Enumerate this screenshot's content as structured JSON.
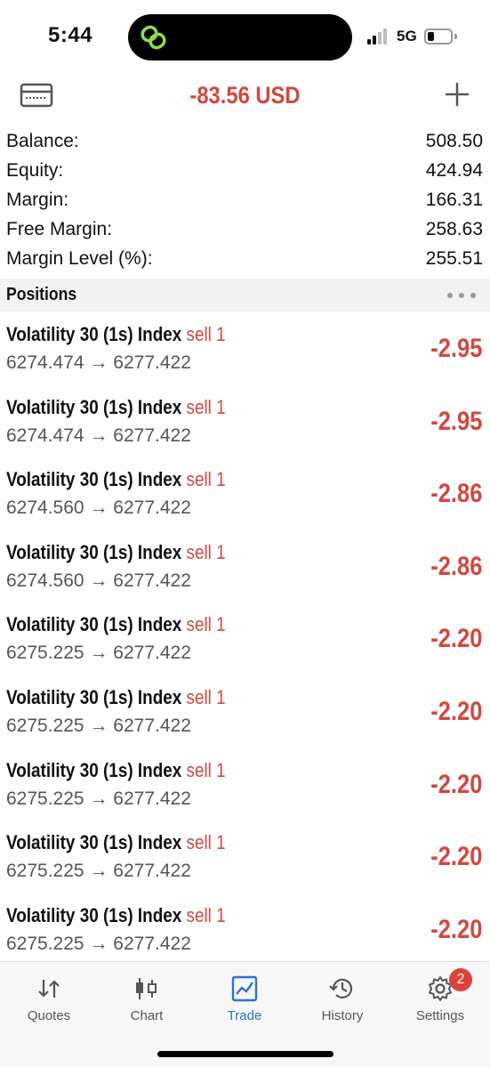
{
  "status_bar": {
    "time": "5:44",
    "network": "5G",
    "island_icon": "linked-rings-icon",
    "island_icon_color": "#8be04e"
  },
  "header": {
    "title": "-83.56 USD",
    "left_icon": "account-card-icon",
    "right_icon": "plus-icon",
    "title_color": "#d2473e"
  },
  "summary": [
    {
      "label": "Balance:",
      "value": "508.50"
    },
    {
      "label": "Equity:",
      "value": "424.94"
    },
    {
      "label": "Margin:",
      "value": "166.31"
    },
    {
      "label": "Free Margin:",
      "value": "258.63"
    },
    {
      "label": "Margin Level (%):",
      "value": "255.51"
    }
  ],
  "positions_section": {
    "title": "Positions",
    "menu_icon": "more-dots-icon"
  },
  "positions": [
    {
      "symbol": "Volatility 30 (1s) Index",
      "type": "sell 1",
      "open_price": "6274.474",
      "arrow": "→",
      "current_price": "6277.422",
      "profit": "-2.95"
    },
    {
      "symbol": "Volatility 30 (1s) Index",
      "type": "sell 1",
      "open_price": "6274.474",
      "arrow": "→",
      "current_price": "6277.422",
      "profit": "-2.95"
    },
    {
      "symbol": "Volatility 30 (1s) Index",
      "type": "sell 1",
      "open_price": "6274.560",
      "arrow": "→",
      "current_price": "6277.422",
      "profit": "-2.86"
    },
    {
      "symbol": "Volatility 30 (1s) Index",
      "type": "sell 1",
      "open_price": "6274.560",
      "arrow": "→",
      "current_price": "6277.422",
      "profit": "-2.86"
    },
    {
      "symbol": "Volatility 30 (1s) Index",
      "type": "sell 1",
      "open_price": "6275.225",
      "arrow": "→",
      "current_price": "6277.422",
      "profit": "-2.20"
    },
    {
      "symbol": "Volatility 30 (1s) Index",
      "type": "sell 1",
      "open_price": "6275.225",
      "arrow": "→",
      "current_price": "6277.422",
      "profit": "-2.20"
    },
    {
      "symbol": "Volatility 30 (1s) Index",
      "type": "sell 1",
      "open_price": "6275.225",
      "arrow": "→",
      "current_price": "6277.422",
      "profit": "-2.20"
    },
    {
      "symbol": "Volatility 30 (1s) Index",
      "type": "sell 1",
      "open_price": "6275.225",
      "arrow": "→",
      "current_price": "6277.422",
      "profit": "-2.20"
    },
    {
      "symbol": "Volatility 30 (1s) Index",
      "type": "sell 1",
      "open_price": "6275.225",
      "arrow": "→",
      "current_price": "6277.422",
      "profit": "-2.20"
    }
  ],
  "tabs": [
    {
      "label": "Quotes",
      "icon": "quotes-arrows-icon"
    },
    {
      "label": "Chart",
      "icon": "candlestick-icon"
    },
    {
      "label": "Trade",
      "icon": "trade-chart-icon",
      "active": true
    },
    {
      "label": "History",
      "icon": "history-clock-icon"
    },
    {
      "label": "Settings",
      "icon": "gear-icon",
      "badge": "2"
    }
  ],
  "colors": {
    "loss_red": "#d2473e",
    "active_tab_blue": "#2a6fd6",
    "badge_red": "#e0413a"
  }
}
